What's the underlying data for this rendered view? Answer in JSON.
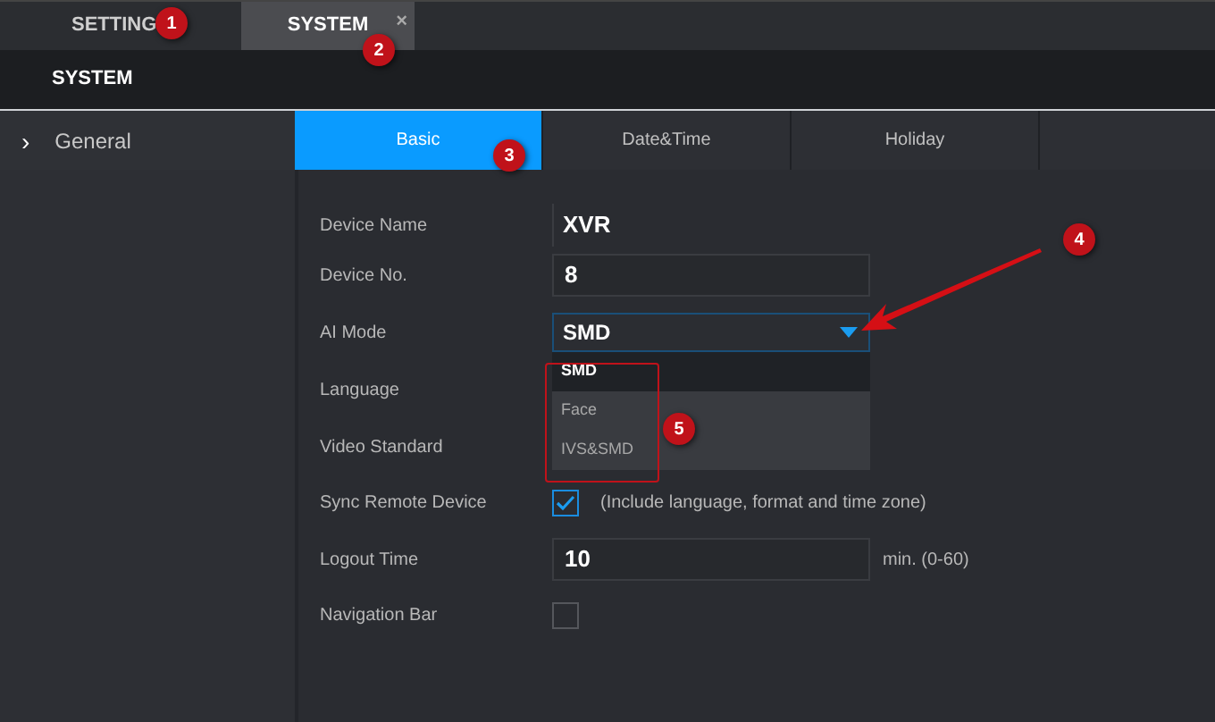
{
  "top_tabs": [
    {
      "label": "SETTING",
      "selected": false
    },
    {
      "label": "SYSTEM",
      "selected": true,
      "close": "×"
    }
  ],
  "header": {
    "title": "SYSTEM"
  },
  "sidebar": {
    "items": [
      {
        "icon": "›",
        "label": "General"
      }
    ]
  },
  "tabs": [
    {
      "label": "Basic",
      "selected": true
    },
    {
      "label": "Date&Time",
      "selected": false
    },
    {
      "label": "Holiday",
      "selected": false
    }
  ],
  "form": [
    {
      "kind": "plain",
      "label": "Device Name",
      "value": "XVR"
    },
    {
      "kind": "input",
      "label": "Device No.",
      "value": "8"
    },
    {
      "kind": "select",
      "label": "AI Mode",
      "value": "SMD",
      "expanded": true,
      "options": [
        {
          "label": "SMD",
          "selected": true
        },
        {
          "label": "Face",
          "selected": false
        },
        {
          "label": "IVS&SMD",
          "selected": false
        }
      ]
    },
    {
      "kind": "label",
      "label": "Language"
    },
    {
      "kind": "label",
      "label": "Video Standard"
    },
    {
      "kind": "checkbox",
      "label": "Sync Remote Device",
      "checked": true,
      "note": "(Include language, format and time zone)"
    },
    {
      "kind": "input",
      "label": "Logout Time",
      "value": "10",
      "unit": "min. (0-60)"
    },
    {
      "kind": "checkbox",
      "label": "Navigation Bar",
      "checked": false
    }
  ],
  "annotations": [
    "1",
    "2",
    "3",
    "4",
    "5"
  ]
}
